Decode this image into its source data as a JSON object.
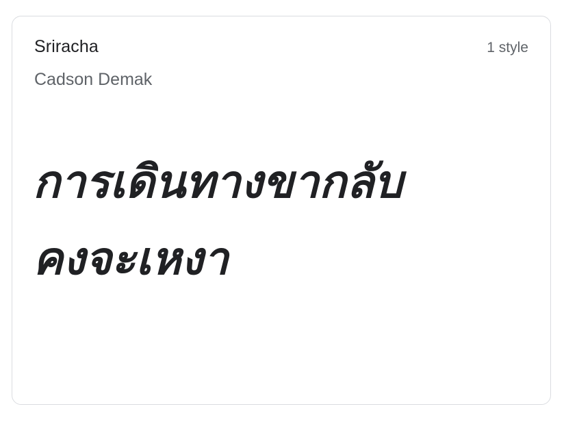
{
  "font_card": {
    "family_name": "Sriracha",
    "designer": "Cadson Demak",
    "style_count": "1 style",
    "preview_lines": [
      "การเดินทางขากลับ",
      "คงจะเหงา"
    ]
  },
  "colors": {
    "text_primary": "#202124",
    "text_secondary": "#5f6368",
    "border": "#dadce0",
    "background": "#ffffff"
  }
}
